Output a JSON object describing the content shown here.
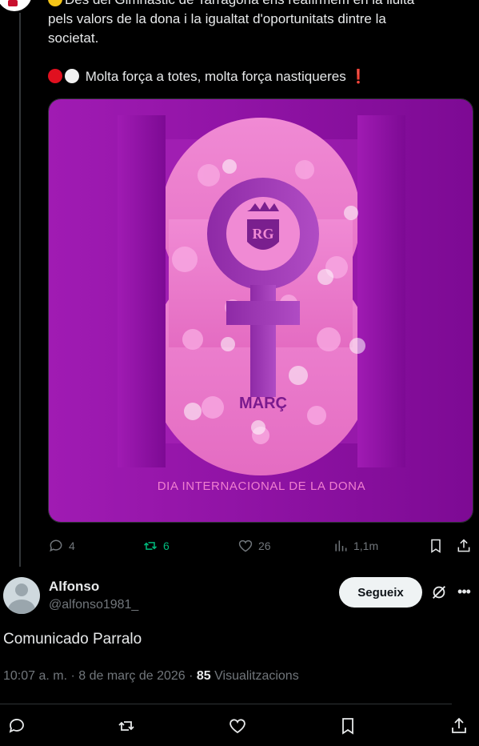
{
  "tweet": {
    "line1": "Des del Gimnàstic de Tarragona ens reafirmem en la lluita",
    "line2": "pels valors de la dona i la igualtat d'oportunitats dintre la",
    "line3": "societat.",
    "line4": "Molta força a totes, molta força nastiqueres",
    "excl": "❗",
    "image": {
      "month": "MARÇ",
      "caption": "DIA INTERNACIONAL DE LA DONA"
    },
    "stats": {
      "replies": "4",
      "reposts": "6",
      "likes": "26",
      "views": "1,1m"
    }
  },
  "reply": {
    "name": "Alfonso",
    "handle": "@alfonso1981_",
    "follow_label": "Segueix",
    "text": "Comunicado Parralo",
    "time": "10:07 a. m. · 8 de març de 2026 · ",
    "views_count": "85",
    "views_label": " Visualitzacions"
  },
  "colors": {
    "accent_green": "#00ba7c",
    "purple": "#8a1aa8",
    "pink": "#e779c8"
  }
}
